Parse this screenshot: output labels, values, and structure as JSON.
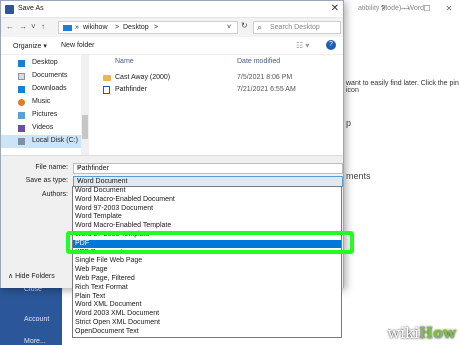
{
  "background": {
    "title": "atibility Mode) · Word",
    "controls": [
      "?",
      "—",
      "☐",
      "✕"
    ],
    "right_text1": "want to easily find later. Click the pin icon",
    "right_text2": "p",
    "right_text3": "ments",
    "left_items": [
      "Close",
      "Account",
      "More..."
    ]
  },
  "dialog": {
    "title": "Save As",
    "close": "✕",
    "nav": {
      "back": "←",
      "forward": "→",
      "down": "˅",
      "up": "↑"
    },
    "address": {
      "root": "»",
      "crumb1": "wikihow",
      "sep": ">",
      "crumb2": "Desktop",
      "dropdown": "˅",
      "refresh": "↻"
    },
    "search_placeholder": "Search Desktop",
    "toolbar": {
      "organize": "Organize ▾",
      "new_folder": "New folder",
      "view": "☷ ▾",
      "help": "?"
    },
    "nav_items": [
      "Desktop",
      "Documents",
      "Downloads",
      "Music",
      "Pictures",
      "Videos",
      "Local Disk (C:)"
    ],
    "columns": {
      "name": "Name",
      "date": "Date modified"
    },
    "files": [
      {
        "name": "Cast Away (2000)",
        "date": "7/5/2021 8:06 PM"
      },
      {
        "name": "Pathfinder",
        "date": "7/21/2021 6:55 AM"
      }
    ],
    "labels": {
      "file_name": "File name:",
      "save_as_type": "Save as type:",
      "authors": "Authors:"
    },
    "file_name_value": "Pathfinder",
    "save_as_type_value": "Word Document",
    "hide_folders": "∧ Hide Folders"
  },
  "dropdown_options": [
    "Word Document",
    "Word Macro-Enabled Document",
    "Word 97-2003 Document",
    "Word Template",
    "Word Macro-Enabled Template",
    "Word 97-2003 Template",
    "PDF",
    "XPS Document",
    "Single File Web Page",
    "Web Page",
    "Web Page, Filtered",
    "Rich Text Format",
    "Plain Text",
    "Word XML Document",
    "Word 2003 XML Document",
    "Strict Open XML Document",
    "OpenDocument Text"
  ],
  "dropdown_selected": "PDF",
  "watermark": {
    "part1": "wiki",
    "part2": "How"
  },
  "colors": {
    "selected": "#0078d7",
    "highlight": "#21ff21",
    "word_blue": "#2b579a"
  }
}
